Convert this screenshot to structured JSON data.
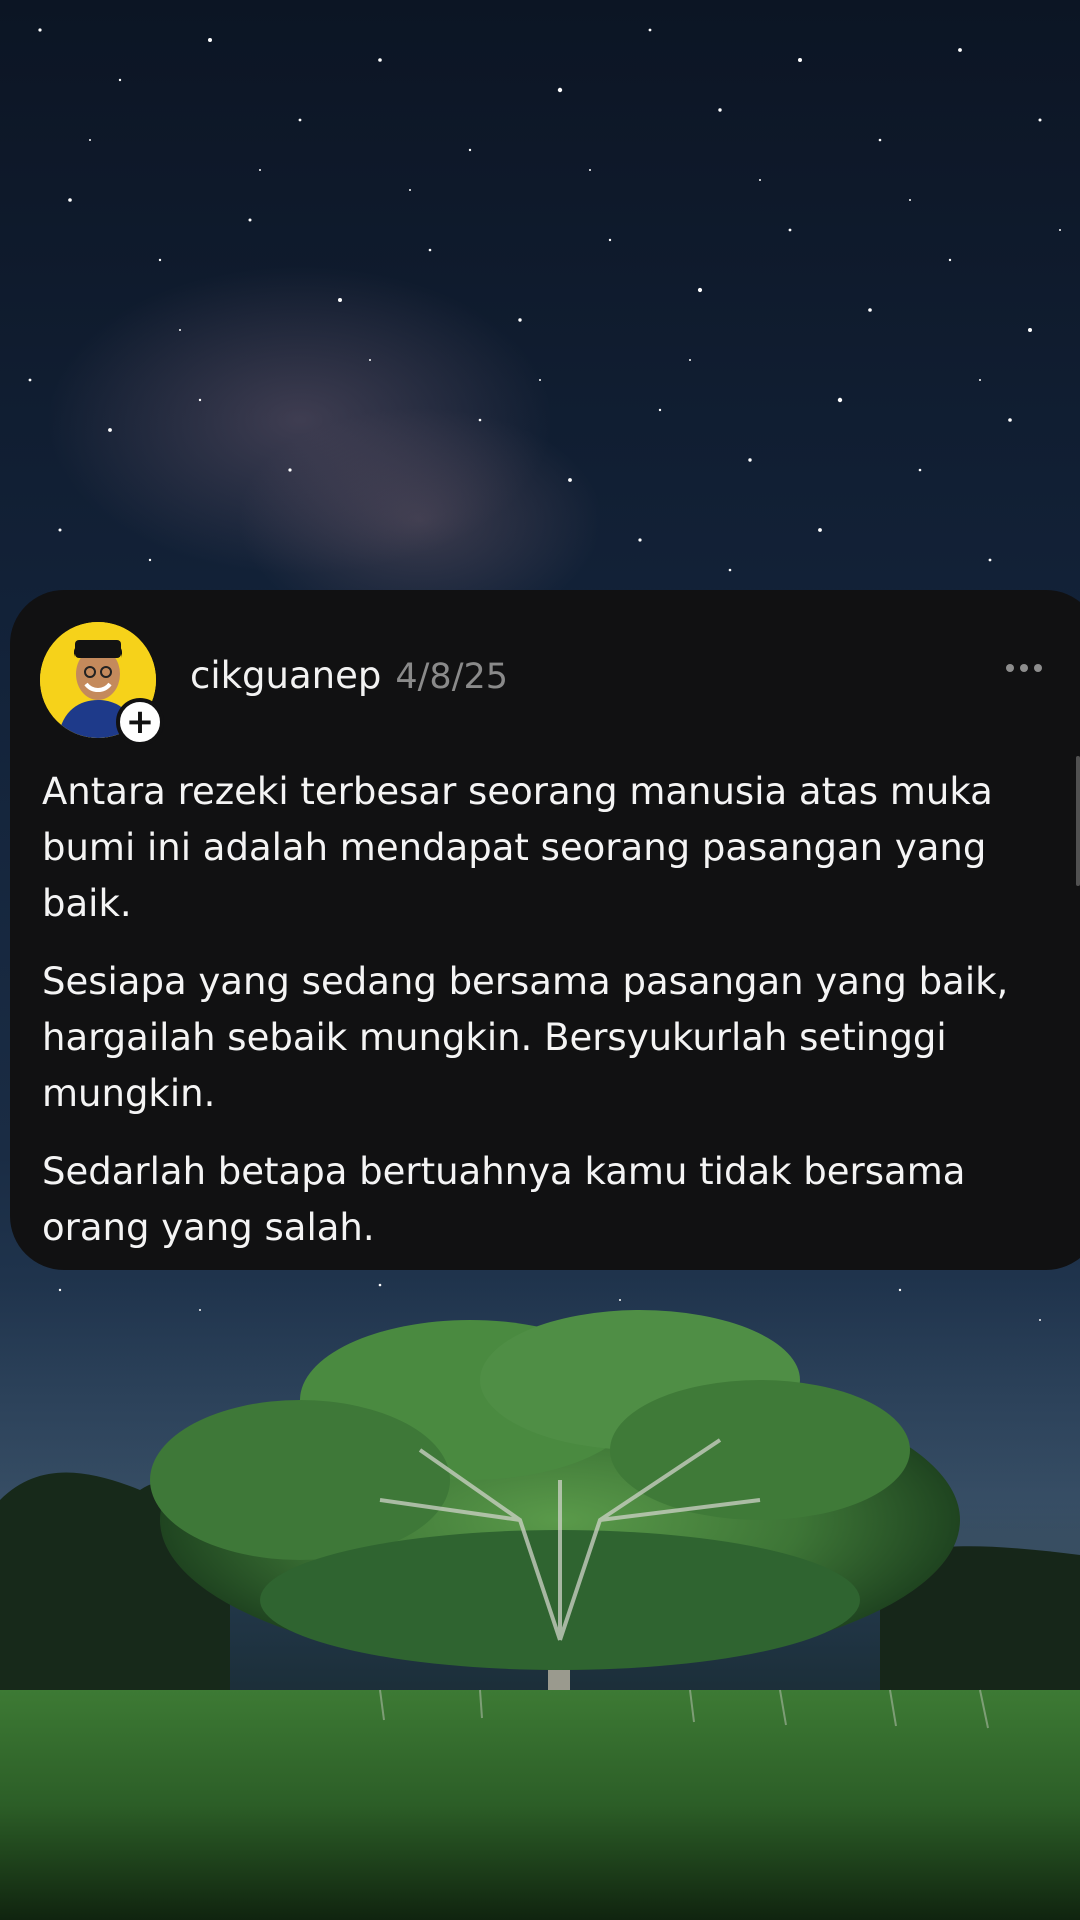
{
  "post": {
    "username": "cikguanep",
    "date": "4/8/25",
    "paragraphs": [
      "Antara rezeki terbesar seorang manusia atas muka bumi ini adalah mendapat seorang pasangan yang baik.",
      "Sesiapa yang sedang bersama pasangan yang baik, hargailah sebaik mungkin. Bersyukurlah setinggi mungkin.",
      "Sedarlah betapa bertuahnya kamu tidak bersama orang yang salah."
    ],
    "follow_symbol": "+",
    "icons": {
      "follow": "plus-icon",
      "more": "more-dots-icon"
    }
  },
  "background": {
    "description_colors": {
      "sky": "#13233a",
      "tree": "#3f7a3a",
      "grass": "#2f6a2c"
    }
  }
}
